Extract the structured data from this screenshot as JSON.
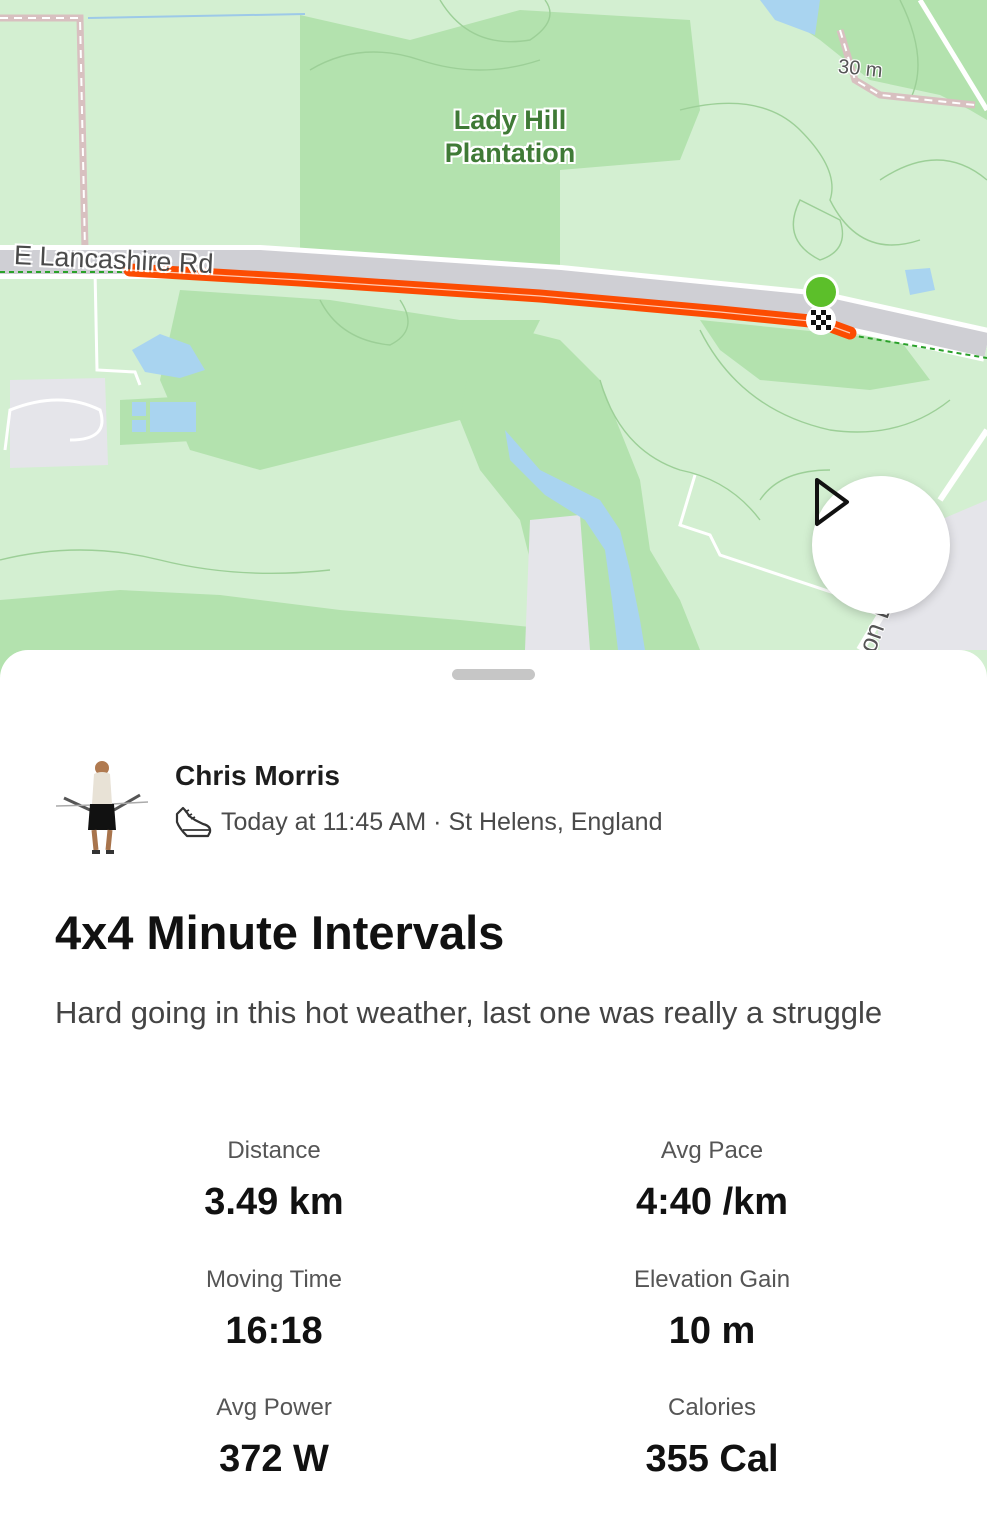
{
  "map": {
    "area_label": "Lady Hill Plantation",
    "road_label": "E Lancashire Rd",
    "scale_label": "30 m",
    "edge_road_label": "on L",
    "route_color": "#fc4c02",
    "start_marker_color": "#5cbf2a",
    "play_button_icon": "play-icon"
  },
  "activity": {
    "athlete_name": "Chris Morris",
    "activity_type_icon": "running-shoe-icon",
    "meta": "Today at 11:45 AM · St Helens, England",
    "title": "4x4 Minute Intervals",
    "description": "Hard going in this hot weather, last one was really a struggle"
  },
  "stats": [
    {
      "label": "Distance",
      "value": "3.49 km"
    },
    {
      "label": "Avg Pace",
      "value": "4:40 /km"
    },
    {
      "label": "Moving Time",
      "value": "16:18"
    },
    {
      "label": "Elevation Gain",
      "value": "10 m"
    },
    {
      "label": "Avg Power",
      "value": "372 W"
    },
    {
      "label": "Calories",
      "value": "355 Cal"
    }
  ]
}
